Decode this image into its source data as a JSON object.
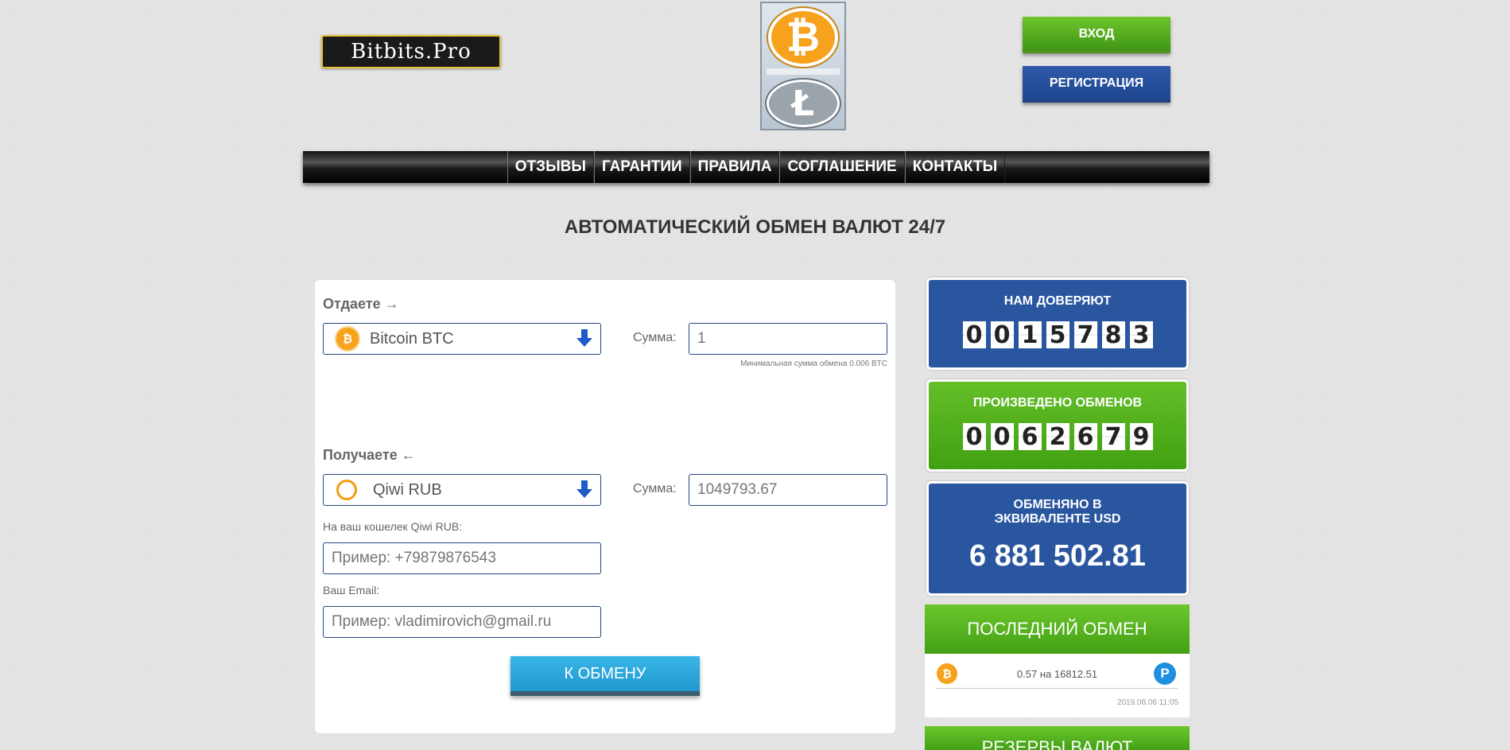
{
  "header": {
    "logo_text": "Bitbits.Pro",
    "login_label": "ВХОД",
    "register_label": "РЕГИСТРАЦИЯ"
  },
  "nav": {
    "items": [
      "ОТЗЫВЫ",
      "ГАРАНТИИ",
      "ПРАВИЛА",
      "СОГЛАШЕНИЕ",
      "КОНТАКТЫ"
    ]
  },
  "page_title": "АВТОМАТИЧЕСКИЙ ОБМЕН ВАЛЮТ 24/7",
  "exchange": {
    "give_label": "Отдаете →",
    "give_currency": "Bitcoin BTC",
    "give_sum_label": "Сумма:",
    "give_sum_value": "1",
    "min_note": "Минимальная сумма обмена 0.006 BTC",
    "get_label": "Получаете ←",
    "get_currency": "Qiwi RUB",
    "get_sum_label": "Сумма:",
    "get_sum_value": "1049793.67",
    "wallet_label": "На ваш кошелек Qiwi RUB:",
    "wallet_placeholder": "Пример: +79879876543",
    "email_label": "Ваш Email:",
    "email_placeholder": "Пример: vladimirovich@gmail.ru",
    "submit_label": "К ОБМЕНУ"
  },
  "stats": {
    "trust_title": "НАМ ДОВЕРЯЮТ",
    "trust_digits": [
      "0",
      "0",
      "1",
      "5",
      "7",
      "8",
      "3"
    ],
    "exchanges_title": "ПРОИЗВЕДЕНО ОБМЕНОВ",
    "exchanges_digits": [
      "0",
      "0",
      "6",
      "2",
      "6",
      "7",
      "9"
    ],
    "usd_title_line1": "ОБМЕНЯНО В",
    "usd_title_line2": "ЭКВИВАЛЕНТЕ USD",
    "usd_value": "6 881 502.81"
  },
  "last_exchange": {
    "title": "ПОСЛЕДНИЙ ОБМЕН",
    "amounts": "0.57 на 16812.51",
    "datetime": "2019.08.06 11:05"
  },
  "reserves": {
    "title": "РЕЗЕРВЫ ВАЛЮТ"
  },
  "colors": {
    "brand_blue": "#2a56a0",
    "brand_green": "#4fae1c",
    "button_cyan": "#2ea9df",
    "bitcoin_orange": "#f7a21c"
  }
}
